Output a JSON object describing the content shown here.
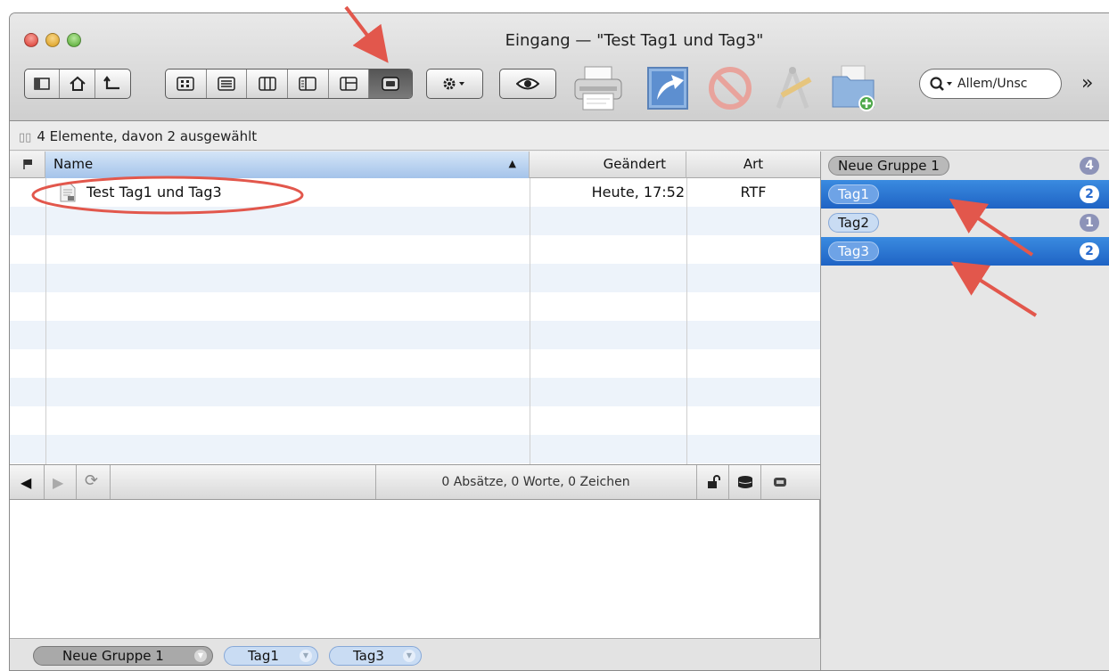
{
  "window": {
    "title": "Eingang — \"Test Tag1 und Tag3\""
  },
  "toolbar": {
    "search_placeholder": "Allem/Unsc",
    "overflow": "»"
  },
  "info": {
    "text": "4 Elemente, davon 2 ausgewählt"
  },
  "table": {
    "columns": {
      "name": "Name",
      "changed": "Geändert",
      "kind": "Art"
    },
    "rows": [
      {
        "name": "Test Tag1 und Tag3",
        "changed": "Heute, 17:52",
        "kind": "RTF"
      }
    ]
  },
  "status": {
    "text": "0 Absätze, 0 Worte, 0 Zeichen"
  },
  "sidebar": {
    "items": [
      {
        "label": "Neue Gruppe 1",
        "count": "4"
      },
      {
        "label": "Tag1",
        "count": "2"
      },
      {
        "label": "Tag2",
        "count": "1"
      },
      {
        "label": "Tag3",
        "count": "2"
      }
    ]
  },
  "tagbar": {
    "tags": [
      "Neue Gruppe 1",
      "Tag1",
      "Tag3"
    ]
  },
  "colors": {
    "selection": "#1f63c4",
    "annotation": "#e2574c",
    "group_pill": "#8d93b8"
  }
}
